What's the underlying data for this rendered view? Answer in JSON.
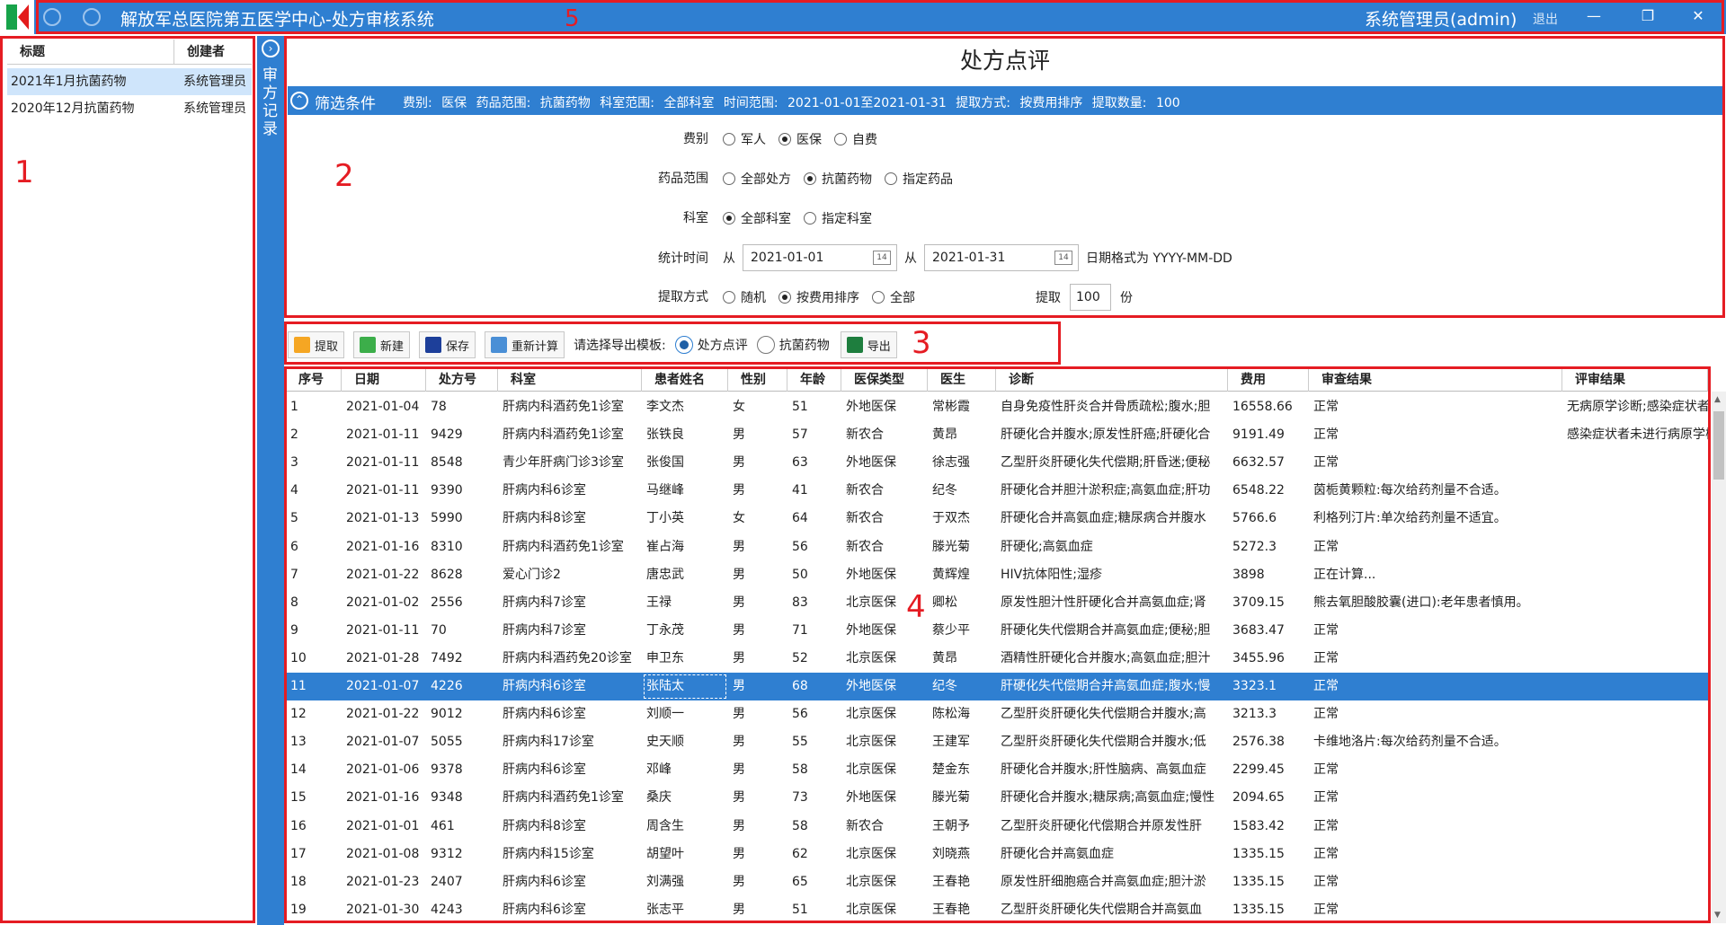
{
  "titlebar": {
    "title": "解放军总医院第五医学中心-处方审核系统",
    "user": "系统管理员(admin)",
    "logout": "退出",
    "minimize": "—",
    "restore": "❐",
    "close": "✕"
  },
  "annotations": [
    "1",
    "2",
    "3",
    "4",
    "5"
  ],
  "left_panel": {
    "columns": [
      "标题",
      "创建者"
    ],
    "rows": [
      {
        "title": "2021年1月抗菌药物",
        "creator": "系统管理员"
      },
      {
        "title": "2020年12月抗菌药物",
        "creator": "系统管理员"
      }
    ]
  },
  "sidebar": {
    "label": "审方记录",
    "toggle": "›"
  },
  "page_title": "处方点评",
  "filter": {
    "title": "筛选条件",
    "summary": "费别: 医保   药品范围: 抗菌药物   科室范围: 全部科室   时间范围: 2021-01-01至2021-01-31   提取方式: 按费用排序   提取数量: 100",
    "fee_label": "费别",
    "fee_options": [
      "军人",
      "医保",
      "自费"
    ],
    "drug_label": "药品范围",
    "drug_options": [
      "全部处方",
      "抗菌药物",
      "指定药品"
    ],
    "dept_label": "科室",
    "dept_options": [
      "全部科室",
      "指定科室"
    ],
    "time_label": "统计时间",
    "from1": "从",
    "from2": "从",
    "date_start": "2021-01-01",
    "date_end": "2021-01-31",
    "date_hint": "日期格式为 YYYY-MM-DD",
    "method_label": "提取方式",
    "method_options": [
      "随机",
      "按费用排序",
      "全部"
    ],
    "count_label": "提取",
    "count_value": "100",
    "count_unit": "份",
    "cal_icon_text": "14"
  },
  "toolbar": {
    "extract": "提取",
    "new": "新建",
    "save": "保存",
    "recalc": "重新计算",
    "template_label": "请选择导出模板:",
    "template_options": [
      "处方点评",
      "抗菌药物"
    ],
    "export": "导出"
  },
  "colors": {
    "accent": "#2f7fd1",
    "annotation_red": "#e51c23"
  },
  "grid": {
    "columns": [
      "序号",
      "日期",
      "处方号",
      "科室",
      "患者姓名",
      "性别",
      "年龄",
      "医保类型",
      "医生",
      "诊断",
      "费用",
      "审查结果",
      "评审结果"
    ],
    "rows": [
      [
        "1",
        "2021-01-04",
        "78",
        "肝病内科酒药免1诊室",
        "李文杰",
        "女",
        "51",
        "外地医保",
        "常彬霞",
        "自身免疫性肝炎合并骨质疏松;腹水;胆",
        "16558.66",
        "正常",
        "无病原学诊断;感染症状者未"
      ],
      [
        "2",
        "2021-01-11",
        "9429",
        "肝病内科酒药免1诊室",
        "张铁良",
        "男",
        "57",
        "新农合",
        "黄昂",
        "肝硬化合并腹水;原发性肝癌;肝硬化合",
        "9191.49",
        "正常",
        "感染症状者未进行病原学检"
      ],
      [
        "3",
        "2021-01-11",
        "8548",
        "青少年肝病门诊3诊室",
        "张俊国",
        "男",
        "63",
        "外地医保",
        "徐志强",
        "乙型肝炎肝硬化失代偿期;肝昏迷;便秘",
        "6632.57",
        "正常",
        ""
      ],
      [
        "4",
        "2021-01-11",
        "9390",
        "肝病内科6诊室",
        "马继峰",
        "男",
        "41",
        "新农合",
        "纪冬",
        "肝硬化合并胆汁淤积症;高氨血症;肝功",
        "6548.22",
        "茵栀黄颗粒:每次给药剂量不合适。",
        ""
      ],
      [
        "5",
        "2021-01-13",
        "5990",
        "肝病内科8诊室",
        "丁小英",
        "女",
        "64",
        "新农合",
        "于双杰",
        "肝硬化合并高氨血症;糖尿病合并腹水",
        "5766.6",
        "利格列汀片:单次给药剂量不适宜。",
        ""
      ],
      [
        "6",
        "2021-01-16",
        "8310",
        "肝病内科酒药免1诊室",
        "崔占海",
        "男",
        "56",
        "新农合",
        "滕光菊",
        "肝硬化;高氨血症",
        "5272.3",
        "正常",
        ""
      ],
      [
        "7",
        "2021-01-22",
        "8628",
        "爱心门诊2",
        "唐忠武",
        "男",
        "50",
        "外地医保",
        "黄辉煌",
        "HIV抗体阳性;湿疹",
        "3898",
        "正在计算...",
        ""
      ],
      [
        "8",
        "2021-01-02",
        "2556",
        "肝病内科7诊室",
        "王禄",
        "男",
        "83",
        "北京医保",
        "卿松",
        "原发性胆汁性肝硬化合并高氨血症;肾",
        "3709.15",
        "熊去氧胆酸胶囊(进口):老年患者慎用。",
        ""
      ],
      [
        "9",
        "2021-01-11",
        "70",
        "肝病内科7诊室",
        "丁永茂",
        "男",
        "71",
        "外地医保",
        "蔡少平",
        "肝硬化失代偿期合并高氨血症;便秘;胆",
        "3683.47",
        "正常",
        ""
      ],
      [
        "10",
        "2021-01-28",
        "7492",
        "肝病内科酒药免20诊室",
        "申卫东",
        "男",
        "52",
        "北京医保",
        "黄昂",
        "酒精性肝硬化合并腹水;高氨血症;胆汁",
        "3455.96",
        "正常",
        ""
      ],
      [
        "11",
        "2021-01-07",
        "4226",
        "肝病内科6诊室",
        "张陆太",
        "男",
        "68",
        "外地医保",
        "纪冬",
        "肝硬化失代偿期合并高氨血症;腹水;慢",
        "3323.1",
        "正常",
        ""
      ],
      [
        "12",
        "2021-01-22",
        "9012",
        "肝病内科6诊室",
        "刘顺一",
        "男",
        "56",
        "北京医保",
        "陈松海",
        "乙型肝炎肝硬化失代偿期合并腹水;高",
        "3213.3",
        "正常",
        ""
      ],
      [
        "13",
        "2021-01-07",
        "5055",
        "肝病内科17诊室",
        "史天顺",
        "男",
        "55",
        "北京医保",
        "王建军",
        "乙型肝炎肝硬化失代偿期合并腹水;低",
        "2576.38",
        "卡维地洛片:每次给药剂量不合适。",
        ""
      ],
      [
        "14",
        "2021-01-06",
        "9378",
        "肝病内科6诊室",
        "邓峰",
        "男",
        "58",
        "北京医保",
        "楚金东",
        "肝硬化合并腹水;肝性脑病、高氨血症",
        "2299.45",
        "正常",
        ""
      ],
      [
        "15",
        "2021-01-16",
        "9348",
        "肝病内科酒药免1诊室",
        "桑庆",
        "男",
        "73",
        "外地医保",
        "滕光菊",
        "肝硬化合并腹水;糖尿病;高氨血症;慢性",
        "2094.65",
        "正常",
        ""
      ],
      [
        "16",
        "2021-01-01",
        "461",
        "肝病内科8诊室",
        "周含生",
        "男",
        "58",
        "新农合",
        "王朝予",
        "乙型肝炎肝硬化代偿期合并原发性肝",
        "1583.42",
        "正常",
        ""
      ],
      [
        "17",
        "2021-01-08",
        "9312",
        "肝病内科15诊室",
        "胡望叶",
        "男",
        "62",
        "北京医保",
        "刘晓燕",
        "肝硬化合并高氨血症",
        "1335.15",
        "正常",
        ""
      ],
      [
        "18",
        "2021-01-23",
        "2407",
        "肝病内科6诊室",
        "刘满强",
        "男",
        "65",
        "北京医保",
        "王春艳",
        "原发性肝细胞癌合并高氨血症;胆汁淤",
        "1335.15",
        "正常",
        ""
      ],
      [
        "19",
        "2021-01-30",
        "4243",
        "肝病内科6诊室",
        "张志平",
        "男",
        "51",
        "北京医保",
        "王春艳",
        "乙型肝炎肝硬化失代偿期合并高氨血",
        "1335.15",
        "正常",
        ""
      ]
    ]
  }
}
